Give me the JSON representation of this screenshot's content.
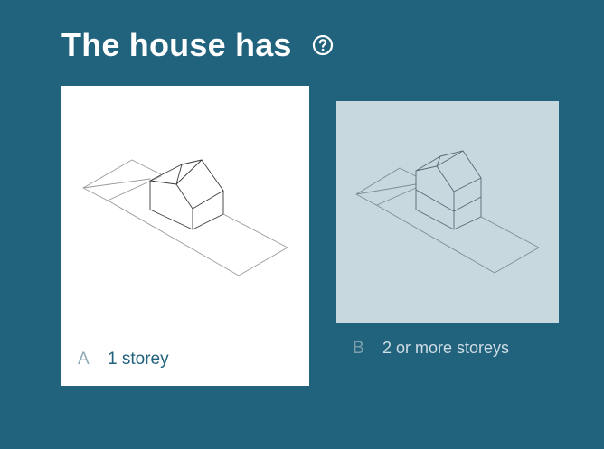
{
  "question": {
    "title": "The house has",
    "help_icon": "question-circle-icon"
  },
  "options": [
    {
      "letter": "A",
      "label": "1 storey",
      "selected": true,
      "image": "one-storey-house-isometric"
    },
    {
      "letter": "B",
      "label": "2 or more storeys",
      "selected": false,
      "image": "two-storey-house-isometric"
    }
  ],
  "colors": {
    "background": "#21627d",
    "selected_card": "#ffffff",
    "unselected_card_image": "#c8d8df",
    "title": "#ffffff"
  }
}
